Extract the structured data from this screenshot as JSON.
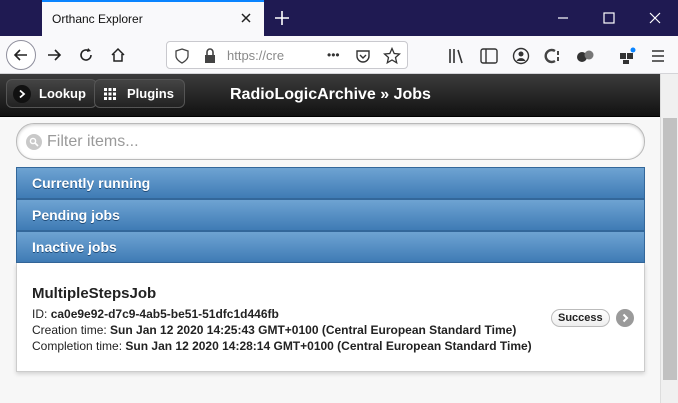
{
  "browser": {
    "tab_title": "Orthanc Explorer",
    "url_text": "https://cre",
    "more_dots": "•••"
  },
  "header": {
    "lookup_label": "Lookup",
    "plugins_label": "Plugins",
    "title": "RadioLogicArchive » Jobs"
  },
  "filter": {
    "placeholder": "Filter items..."
  },
  "sections": {
    "running": "Currently running",
    "pending": "Pending jobs",
    "inactive": "Inactive jobs"
  },
  "job": {
    "name": "MultipleStepsJob",
    "id_label": "ID:",
    "id_value": "ca0e9e92-d7c9-4ab5-be51-51dfc1d446fb",
    "creation_label": "Creation time:",
    "creation_value": "Sun Jan 12 2020 14:25:43 GMT+0100 (Central European Standard Time)",
    "completion_label": "Completion time:",
    "completion_value": "Sun Jan 12 2020 14:28:14 GMT+0100 (Central European Standard Time)",
    "status": "Success"
  },
  "colors": {
    "tabbar": "#1f1a52",
    "section_blue": "#4f8cc4",
    "header_dark": "#222222"
  }
}
